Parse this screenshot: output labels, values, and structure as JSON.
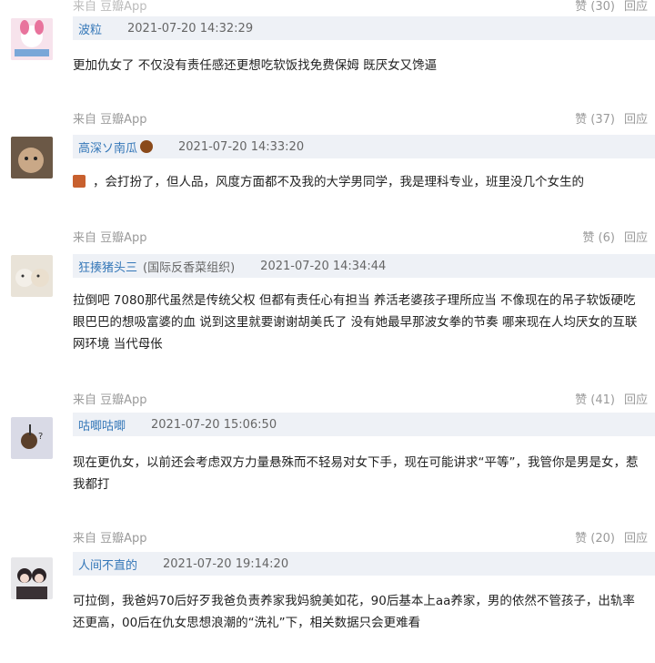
{
  "top_meta": {
    "votes": "赞 (30)",
    "reply": "回应"
  },
  "comments": [
    {
      "user": "波粒",
      "time": "2021-07-20 14:32:29",
      "text": "更加仇女了 不仅没有责任感还更想吃软饭找免费保姆 既厌女又馋逼",
      "source": "来自 豆瓣App",
      "votes": "赞 (37)",
      "reply": "回应"
    },
    {
      "user": "高深ソ南瓜",
      "time": "2021-07-20 14:33:20",
      "text": "，会打扮了，但人品，风度方面都不及我的大学男同学，我是理科专业，班里没几个女生的",
      "source": "来自 豆瓣App",
      "votes": "赞 (6)",
      "reply": "回应"
    },
    {
      "user": "狂揍猪头三",
      "tag": "(国际反香菜组织)",
      "time": "2021-07-20 14:34:44",
      "text": "拉倒吧 7080那代虽然是传统父权 但都有责任心有担当 养活老婆孩子理所应当 不像现在的吊子软饭硬吃 眼巴巴的想吸富婆的血 说到这里就要谢谢胡美氏了 没有她最早那波女拳的节奏 哪来现在人均厌女的互联网环境 当代母伥",
      "source": "来自 豆瓣App",
      "votes": "赞 (41)",
      "reply": "回应"
    },
    {
      "user": "咕唧咕唧",
      "time": "2021-07-20 15:06:50",
      "text": "现在更仇女，以前还会考虑双方力量悬殊而不轻易对女下手，现在可能讲求“平等”，我管你是男是女，惹我都打",
      "source": "来自 豆瓣App",
      "votes": "赞 (20)",
      "reply": "回应"
    },
    {
      "user": "人间不直的",
      "time": "2021-07-20 19:14:20",
      "text": "可拉倒，我爸妈70后好歹我爸负责养家我妈貌美如花，90后基本上aa养家，男的依然不管孩子，出轨率还更高，00后在仇女思想浪潮的“洗礼”下，相关数据只会更难看"
    }
  ],
  "colors": {
    "username": "#3477b8",
    "userbar_bg": "#eef1f6",
    "meta": "#9a9a9a"
  }
}
